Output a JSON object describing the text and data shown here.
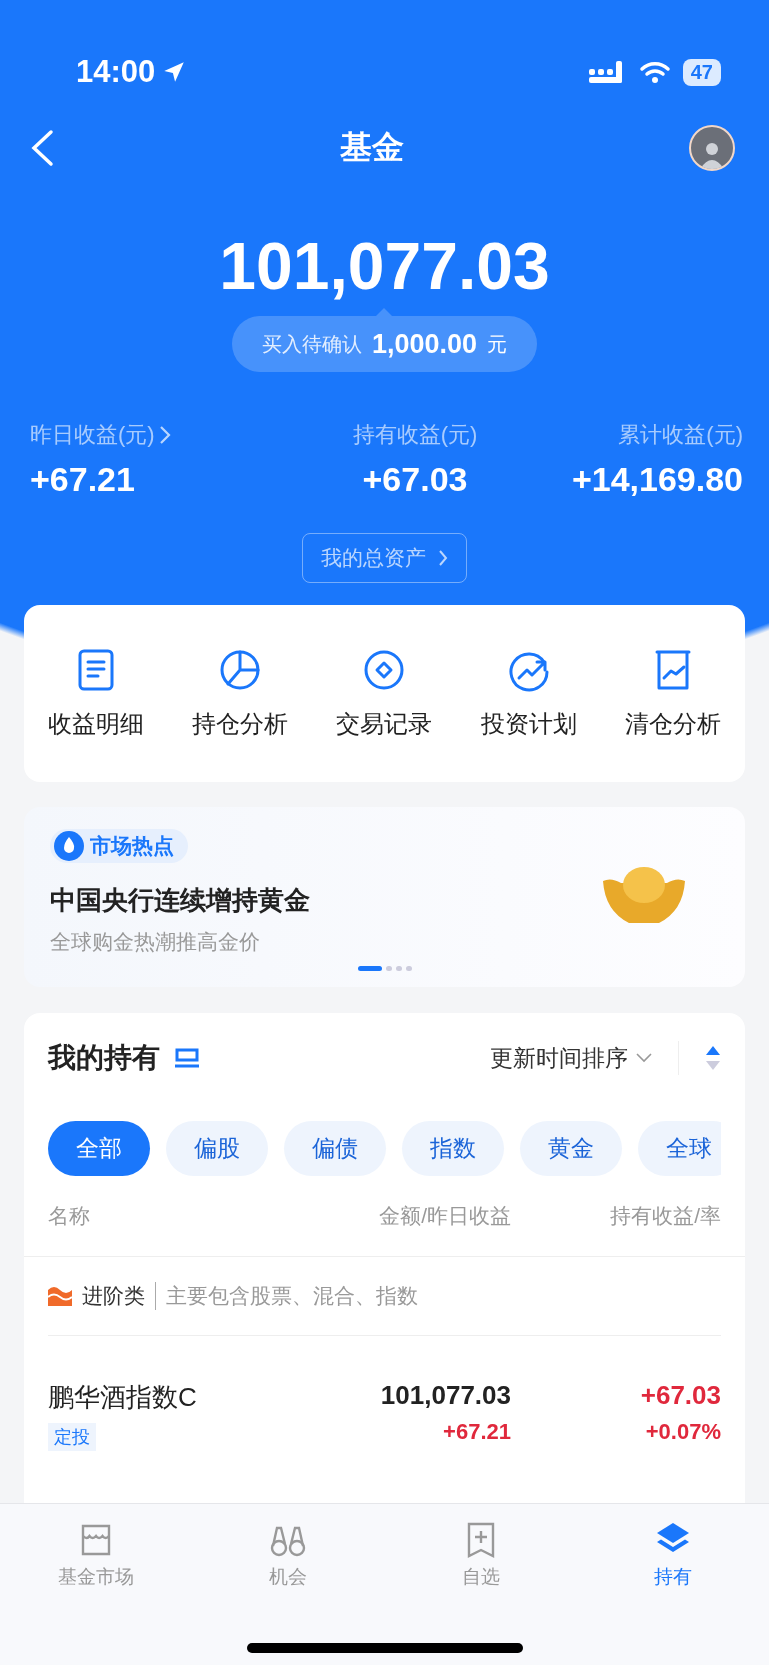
{
  "status_bar": {
    "time": "14:00",
    "battery": "47"
  },
  "nav": {
    "title": "基金"
  },
  "summary": {
    "amount": "101,077.03",
    "pending": {
      "label": "买入待确认",
      "amount": "1,000.00",
      "unit": "元"
    }
  },
  "stats": [
    {
      "label": "昨日收益(元)",
      "value": "+67.21",
      "has_arrow": true
    },
    {
      "label": "持有收益(元)",
      "value": "+67.03",
      "has_arrow": false
    },
    {
      "label": "累计收益(元)",
      "value": "+14,169.80",
      "has_arrow": false
    }
  ],
  "assets_button": "我的总资产",
  "actions": [
    {
      "label": "收益明细"
    },
    {
      "label": "持仓分析"
    },
    {
      "label": "交易记录"
    },
    {
      "label": "投资计划"
    },
    {
      "label": "清仓分析"
    }
  ],
  "banner": {
    "tag": "市场热点",
    "title": "中国央行连续增持黄金",
    "subtitle": "全球购金热潮推高金价",
    "pages": [
      {
        "selected": true
      },
      {
        "selected": false
      },
      {
        "selected": false
      },
      {
        "selected": false
      }
    ]
  },
  "holdings": {
    "title": "我的持有",
    "sort": "更新时间排序",
    "chips": [
      {
        "label": "全部",
        "selected": true
      },
      {
        "label": "偏股",
        "selected": false
      },
      {
        "label": "偏债",
        "selected": false
      },
      {
        "label": "指数",
        "selected": false
      },
      {
        "label": "黄金",
        "selected": false
      },
      {
        "label": "全球",
        "selected": false
      }
    ],
    "columns": [
      "名称",
      "金额/昨日收益",
      "持有收益/率"
    ],
    "category": {
      "name": "进阶类",
      "description": "主要包含股票、混合、指数"
    },
    "funds": [
      {
        "name": "鹏华酒指数C",
        "tag": "定投",
        "amount": "101,077.03",
        "yesterday": "+67.21",
        "profit": "+67.03",
        "rate": "+0.07%"
      }
    ]
  },
  "tab_bar": [
    {
      "label": "基金市场",
      "selected": false
    },
    {
      "label": "机会",
      "selected": false
    },
    {
      "label": "自选",
      "selected": false
    },
    {
      "label": "持有",
      "selected": true
    }
  ]
}
